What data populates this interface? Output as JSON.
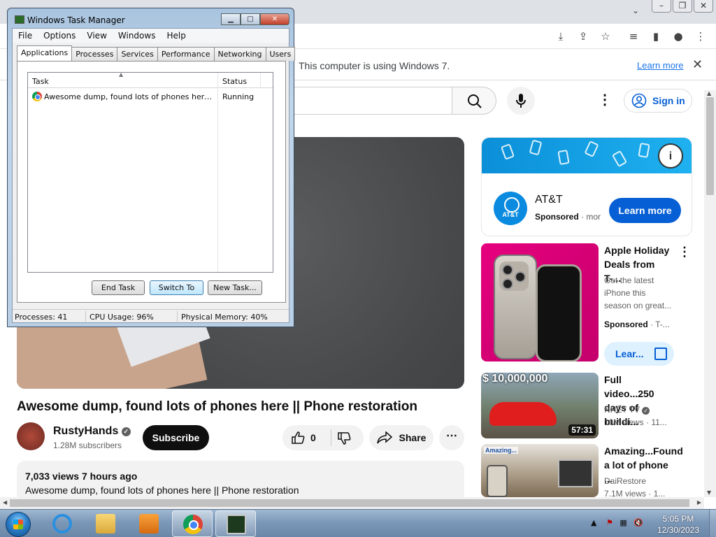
{
  "chrome": {
    "infobar_message": "This computer is using Windows 7.",
    "infobar_link": "Learn more",
    "close_glyph": "✕",
    "window_buttons": [
      "–",
      "❐",
      "✕"
    ],
    "tab_chevron": "⌄"
  },
  "youtube": {
    "sign_in": "Sign in",
    "video_title": "Awesome dump, found lots of phones here || Phone restoration",
    "channel_name": "RustyHands",
    "channel_subs": "1.28M subscribers",
    "subscribe": "Subscribe",
    "likes": "0",
    "share": "Share",
    "views_meta": "7,033 views  7 hours ago",
    "description_line": "Awesome dump, found lots of phones here || Phone restoration",
    "ad": {
      "advertiser": "AT&T",
      "logo_text": "AT&T",
      "sponsored": "Sponsored",
      "sponsored_more": " · mor",
      "learn_more": "Learn more"
    },
    "recommendations": [
      {
        "title": "Apple Holiday Deals from T-...",
        "desc": "Get the latest iPhone this season on great...",
        "channel": "Sponsored",
        "channel_suffix": " · T-...",
        "cta": "Lear..."
      },
      {
        "title": "Full video...250 days of buildi...",
        "channel": "NHẾT TV",
        "stats": "10M views · 11...",
        "duration": "57:31",
        "overlay": "$ 10,000,000"
      },
      {
        "title": "Amazing...Found a lot of phone ...",
        "channel": "DaiRestore",
        "stats": "7.1M views · 1...",
        "overlay": "Amazing..."
      }
    ]
  },
  "task_manager": {
    "title": "Windows Task Manager",
    "menu": [
      "File",
      "Options",
      "View",
      "Windows",
      "Help"
    ],
    "tabs": [
      "Applications",
      "Processes",
      "Services",
      "Performance",
      "Networking",
      "Users"
    ],
    "columns": [
      "Task",
      "Status"
    ],
    "rows": [
      {
        "task": "Awesome dump, found lots of phones here || Ph...",
        "status": "Running"
      }
    ],
    "buttons": [
      "End Task",
      "Switch To",
      "New Task..."
    ],
    "status": {
      "processes": "Processes: 41",
      "cpu": "CPU Usage: 96%",
      "memory": "Physical Memory: 40%"
    }
  },
  "taskbar": {
    "time": "5:05 PM",
    "date": "12/30/2023"
  }
}
